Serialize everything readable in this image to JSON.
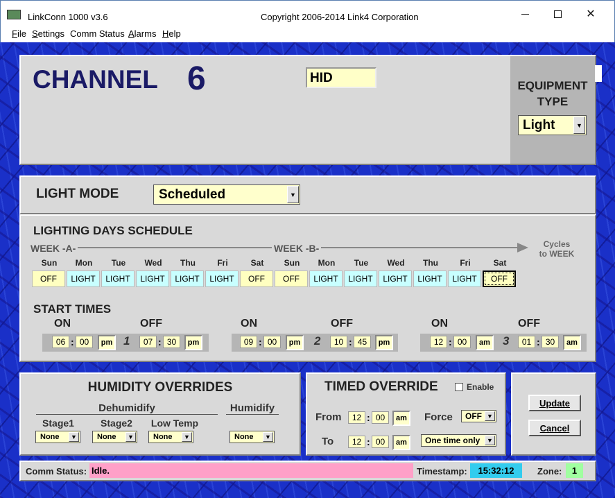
{
  "window": {
    "title": "LinkConn 1000 v3.6",
    "copyright": "Copyright 2006-2014 Link4 Corporation"
  },
  "menu": [
    {
      "first": "F",
      "rest": "ile"
    },
    {
      "first": "S",
      "rest": "ettings"
    },
    {
      "first": "C",
      "rest": "omm Status"
    },
    {
      "first": "A",
      "rest": "larms"
    },
    {
      "first": "H",
      "rest": "elp"
    }
  ],
  "channel": {
    "label": "CHANNEL",
    "number": "6",
    "name": "HID"
  },
  "equipment": {
    "label_line1": "EQUIPMENT",
    "label_line2": "TYPE",
    "value": "Light"
  },
  "light_mode": {
    "label": "LIGHT MODE",
    "value": "Scheduled"
  },
  "schedule": {
    "title": "LIGHTING DAYS SCHEDULE",
    "week_a": "WEEK -A-",
    "week_b": "WEEK -B-",
    "cycles_line1": "Cycles",
    "cycles_line2": "to WEEK",
    "days": [
      {
        "day": "Sun",
        "state": "OFF"
      },
      {
        "day": "Mon",
        "state": "LIGHT"
      },
      {
        "day": "Tue",
        "state": "LIGHT"
      },
      {
        "day": "Wed",
        "state": "LIGHT"
      },
      {
        "day": "Thu",
        "state": "LIGHT"
      },
      {
        "day": "Fri",
        "state": "LIGHT"
      },
      {
        "day": "Sat",
        "state": "OFF"
      },
      {
        "day": "Sun",
        "state": "OFF"
      },
      {
        "day": "Mon",
        "state": "LIGHT"
      },
      {
        "day": "Tue",
        "state": "LIGHT"
      },
      {
        "day": "Wed",
        "state": "LIGHT"
      },
      {
        "day": "Thu",
        "state": "LIGHT"
      },
      {
        "day": "Fri",
        "state": "LIGHT"
      },
      {
        "day": "Sat",
        "state": "OFF"
      }
    ]
  },
  "start_times": {
    "title": "START TIMES",
    "on_label": "ON",
    "off_label": "OFF",
    "periods": [
      {
        "num": "1",
        "on_h": "06",
        "on_m": "00",
        "on_ap": "pm",
        "off_h": "07",
        "off_m": "30",
        "off_ap": "pm"
      },
      {
        "num": "2",
        "on_h": "09",
        "on_m": "00",
        "on_ap": "pm",
        "off_h": "10",
        "off_m": "45",
        "off_ap": "pm"
      },
      {
        "num": "3",
        "on_h": "12",
        "on_m": "00",
        "on_ap": "am",
        "off_h": "01",
        "off_m": "30",
        "off_ap": "am"
      }
    ]
  },
  "humidity": {
    "title": "HUMIDITY OVERRIDES",
    "dehumidify": "Dehumidify",
    "humidify": "Humidify",
    "stage1": "Stage1",
    "stage2": "Stage2",
    "low_temp": "Low Temp",
    "stage1_value": "None",
    "stage2_value": "None",
    "low_temp_value": "None",
    "humidify_value": "None"
  },
  "timed": {
    "title": "TIMED OVERRIDE",
    "enable": "Enable",
    "from": "From",
    "to": "To",
    "from_h": "12",
    "from_m": "00",
    "from_ap": "am",
    "to_h": "12",
    "to_m": "00",
    "to_ap": "am",
    "force": "Force",
    "force_value": "OFF",
    "duration_value": "One time only"
  },
  "buttons": {
    "update": "Update",
    "cancel": "Cancel"
  },
  "status": {
    "comm_label": "Comm Status:",
    "comm_value": "Idle.",
    "timestamp_label": "Timestamp:",
    "timestamp_value": "15:32:12",
    "zone_label": "Zone:",
    "zone_value": "1"
  }
}
